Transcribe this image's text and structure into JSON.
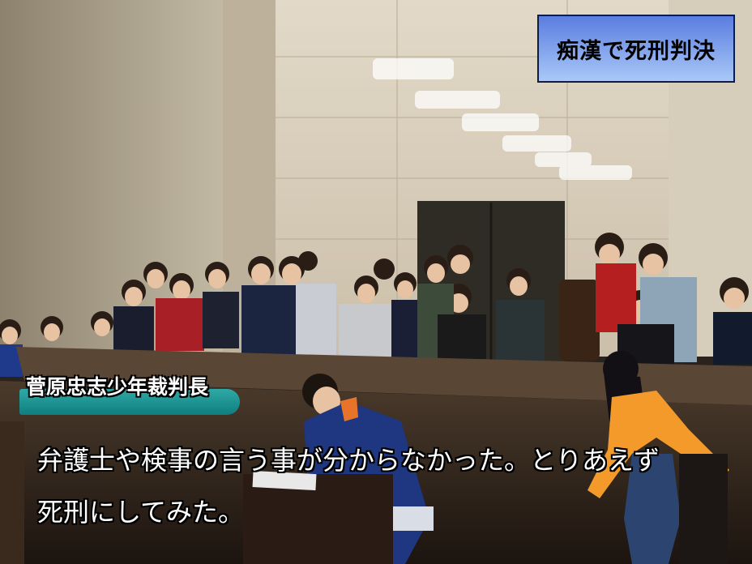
{
  "caption": {
    "title": "痴漢で死刑判決"
  },
  "speaker": {
    "name": "菅原忠志少年裁判長"
  },
  "subtitle": {
    "line1": "弁護士や検事の言う事が分からなかった。とりあえず",
    "line2": "死刑にしてみた。"
  },
  "colors": {
    "caption_bg_top": "#5a7de0",
    "caption_bg_bottom": "#a9c8f7",
    "speaker_tag": "#1a9a98",
    "subtitle_text": "#ffffff"
  }
}
